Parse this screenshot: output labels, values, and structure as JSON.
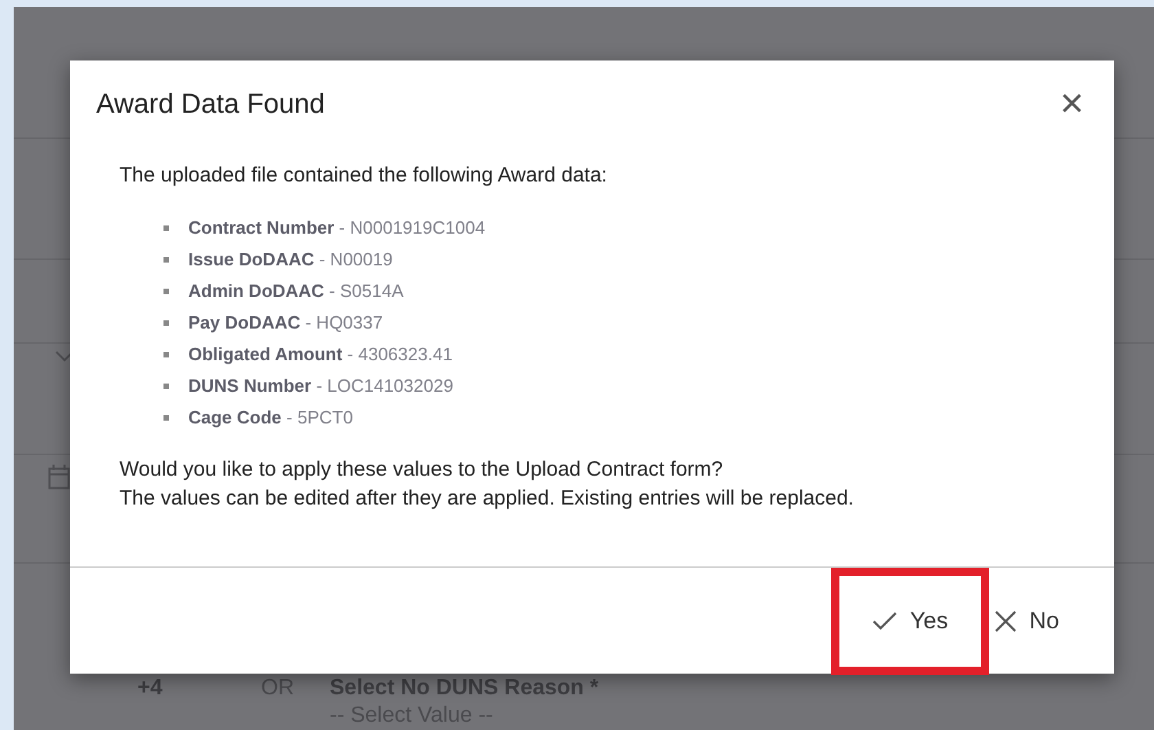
{
  "background_form": {
    "row_number": "+4",
    "separator": "OR",
    "field_label": "Select No DUNS Reason *",
    "field_placeholder": "-- Select Value --"
  },
  "dialog": {
    "title": "Award Data Found",
    "close": "×",
    "intro": "The uploaded file contained the following Award data:",
    "items": [
      {
        "label": "Contract Number",
        "separator": "-",
        "value": "N0001919C1004"
      },
      {
        "label": "Issue DoDAAC",
        "separator": "-",
        "value": "N00019"
      },
      {
        "label": "Admin DoDAAC",
        "separator": "-",
        "value": "S0514A"
      },
      {
        "label": "Pay DoDAAC",
        "separator": "-",
        "value": "HQ0337"
      },
      {
        "label": "Obligated Amount",
        "separator": "-",
        "value": "4306323.41"
      },
      {
        "label": "DUNS Number",
        "separator": "-",
        "value": "LOC141032029"
      },
      {
        "label": "Cage Code",
        "separator": "-",
        "value": "5PCT0"
      }
    ],
    "question": "Would you like to apply these values to the Upload Contract form?",
    "note": "The values can be edited after they are applied. Existing entries will be replaced.",
    "buttons": [
      {
        "kind": "confirm",
        "label": "Yes",
        "highlighted": true
      },
      {
        "kind": "cancel",
        "label": "No",
        "highlighted": false
      }
    ]
  }
}
